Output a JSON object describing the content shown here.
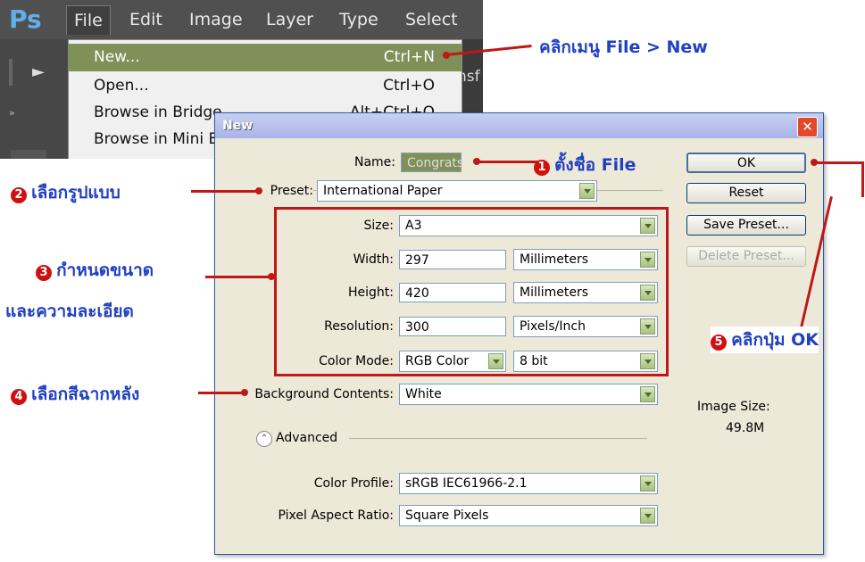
{
  "app": {
    "logo": "Ps"
  },
  "menubar": [
    "File",
    "Edit",
    "Image",
    "Layer",
    "Type",
    "Select"
  ],
  "file_menu": {
    "items": [
      {
        "label": "New...",
        "shortcut": "Ctrl+N"
      },
      {
        "label": "Open...",
        "shortcut": "Ctrl+O"
      },
      {
        "label": "Browse in Bridge...",
        "shortcut": "Alt+Ctrl+O"
      },
      {
        "label": "Browse in Mini Bridge...",
        "shortcut": ""
      }
    ],
    "edge_text": "nsf"
  },
  "dialog": {
    "title": "New",
    "close": "✕",
    "name_label": "Name:",
    "name_value": "Congrats",
    "preset_label": "Preset:",
    "preset_value": "International Paper",
    "size_label": "Size:",
    "size_value": "A3",
    "width_label": "Width:",
    "width_value": "297",
    "width_unit": "Millimeters",
    "height_label": "Height:",
    "height_value": "420",
    "height_unit": "Millimeters",
    "resolution_label": "Resolution:",
    "resolution_value": "300",
    "resolution_unit": "Pixels/Inch",
    "color_mode_label": "Color Mode:",
    "color_mode_value": "RGB Color",
    "bit_depth": "8 bit",
    "background_label": "Background Contents:",
    "background_value": "White",
    "advanced_label": "Advanced",
    "color_profile_label": "Color Profile:",
    "color_profile_value": "sRGB IEC61966-2.1",
    "pixel_aspect_label": "Pixel Aspect Ratio:",
    "pixel_aspect_value": "Square Pixels",
    "buttons": {
      "ok": "OK",
      "reset": "Reset",
      "save_preset": "Save Preset...",
      "delete_preset": "Delete Preset..."
    },
    "image_size_label": "Image Size:",
    "image_size_value": "49.8M"
  },
  "annotations": {
    "file_new": "คลิกเมนู File > New",
    "step1_num": "1",
    "step1": "ตั้งชื่อ File",
    "step2_num": "2",
    "step2": "เลือกรูปแบบ",
    "step3_num": "3",
    "step3_line1": "กำหนดขนาด",
    "step3_line2": "และความละเอียด",
    "step4_num": "4",
    "step4": "เลือกสีฉากหลัง",
    "step5_num": "5",
    "step5": "คลิกปุ่ม OK"
  },
  "colors": {
    "annotation_text": "#2040c0",
    "annotation_line": "#c01818",
    "highlight": "#7f9058"
  }
}
